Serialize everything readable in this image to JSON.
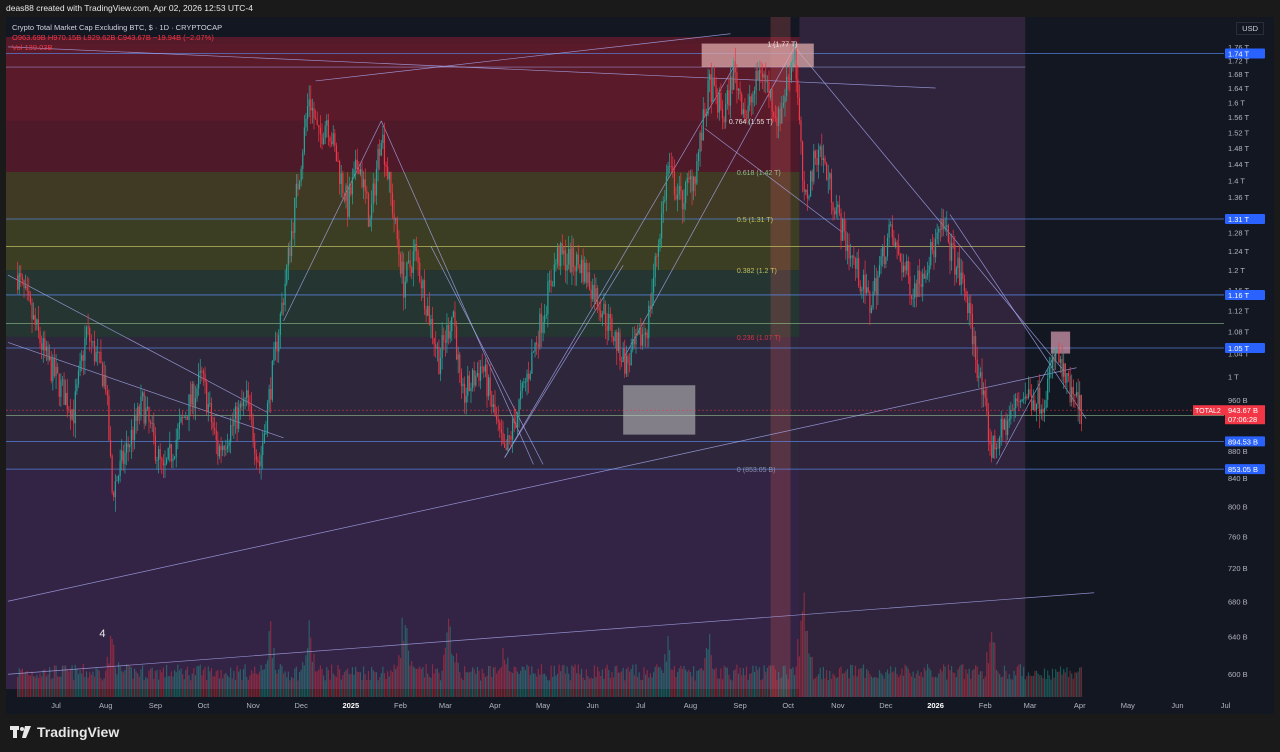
{
  "header": {
    "attribution": "deas88 created with TradingView.com, Apr 02, 2026 12:53 UTC-4"
  },
  "legend": {
    "symbol": "Crypto Total Market Cap Excluding BTC, $ · 1D · CRYPTOCAP",
    "ohlc": "O963.69B H970.15B L929.62B C943.67B −19.94B (−2.07%)",
    "volume": "Vol  139.03B"
  },
  "currency": "USD",
  "footer": {
    "brand": "TradingView"
  },
  "colors": {
    "background": "#131722",
    "up": "#26a69a",
    "down": "#f23645",
    "trendline": "#b2b5ff",
    "level": "#5b8def"
  },
  "chart_data": {
    "type": "candlestick",
    "title": "Crypto Total Market Cap Excluding BTC",
    "interval": "1D",
    "exchange": "CRYPTOCAP",
    "y_scale": "log",
    "ylim": [
      585,
      1790
    ],
    "y_ticks": [
      {
        "value": 600,
        "label": "600 B"
      },
      {
        "value": 640,
        "label": "640 B"
      },
      {
        "value": 680,
        "label": "680 B"
      },
      {
        "value": 720,
        "label": "720 B"
      },
      {
        "value": 760,
        "label": "760 B"
      },
      {
        "value": 800,
        "label": "800 B"
      },
      {
        "value": 840,
        "label": "840 B"
      },
      {
        "value": 880,
        "label": "880 B"
      },
      {
        "value": 960,
        "label": "960 B"
      },
      {
        "value": 1000,
        "label": "1 T"
      },
      {
        "value": 1040,
        "label": "1.04 T"
      },
      {
        "value": 1080,
        "label": "1.08 T"
      },
      {
        "value": 1120,
        "label": "1.12 T"
      },
      {
        "value": 1160,
        "label": "1.16 T"
      },
      {
        "value": 1200,
        "label": "1.2 T"
      },
      {
        "value": 1240,
        "label": "1.24 T"
      },
      {
        "value": 1280,
        "label": "1.28 T"
      },
      {
        "value": 1360,
        "label": "1.36 T"
      },
      {
        "value": 1400,
        "label": "1.4 T"
      },
      {
        "value": 1440,
        "label": "1.44 T"
      },
      {
        "value": 1480,
        "label": "1.48 T"
      },
      {
        "value": 1520,
        "label": "1.52 T"
      },
      {
        "value": 1560,
        "label": "1.56 T"
      },
      {
        "value": 1600,
        "label": "1.6 T"
      },
      {
        "value": 1640,
        "label": "1.64 T"
      },
      {
        "value": 1680,
        "label": "1.68 T"
      },
      {
        "value": 1720,
        "label": "1.72 T"
      },
      {
        "value": 1760,
        "label": "1.76 T"
      }
    ],
    "price_badges": [
      {
        "value": 1740,
        "label": "1.74 T"
      },
      {
        "value": 1310,
        "label": "1.31 T"
      },
      {
        "value": 1150,
        "label": "1.16 T"
      },
      {
        "value": 1050,
        "label": "1.05 T"
      },
      {
        "value": 894.53,
        "label": "894.53 B"
      },
      {
        "value": 853.05,
        "label": "853.05 B"
      }
    ],
    "last_price": {
      "symbol": "TOTAL2",
      "value": 943.67,
      "label": "943.67 B",
      "countdown": "07:06:28"
    },
    "x_ticks": [
      "Jul",
      "Aug",
      "Sep",
      "Oct",
      "Nov",
      "Dec",
      "2025",
      "Feb",
      "Mar",
      "Apr",
      "May",
      "Jun",
      "Jul",
      "Aug",
      "Sep",
      "Oct",
      "Nov",
      "Dec",
      "2026",
      "Feb",
      "Mar",
      "Apr",
      "May",
      "Jun",
      "Jul"
    ],
    "x_tick_dates": [
      "2024-07-01",
      "2024-08-01",
      "2024-09-01",
      "2024-10-01",
      "2024-11-01",
      "2024-12-01",
      "2025-01-01",
      "2025-02-01",
      "2025-03-01",
      "2025-04-01",
      "2025-05-01",
      "2025-06-01",
      "2025-07-01",
      "2025-08-01",
      "2025-09-01",
      "2025-10-01",
      "2025-11-01",
      "2025-12-01",
      "2026-01-01",
      "2026-02-01",
      "2026-03-01",
      "2026-04-01",
      "2026-05-01",
      "2026-06-01",
      "2026-07-01"
    ],
    "price_path": [
      [
        "2024-06-07",
        1190
      ],
      [
        "2024-06-25",
        1030
      ],
      [
        "2024-07-12",
        940
      ],
      [
        "2024-07-20",
        1080
      ],
      [
        "2024-08-01",
        990
      ],
      [
        "2024-08-05",
        820
      ],
      [
        "2024-08-24",
        955
      ],
      [
        "2024-09-06",
        845
      ],
      [
        "2024-09-20",
        940
      ],
      [
        "2024-09-30",
        1000
      ],
      [
        "2024-10-10",
        880
      ],
      [
        "2024-10-28",
        960
      ],
      [
        "2024-11-05",
        860
      ],
      [
        "2024-11-20",
        1150
      ],
      [
        "2024-12-06",
        1620
      ],
      [
        "2024-12-12",
        1500
      ],
      [
        "2024-12-17",
        1560
      ],
      [
        "2024-12-30",
        1340
      ],
      [
        "2025-01-06",
        1450
      ],
      [
        "2025-01-13",
        1300
      ],
      [
        "2025-01-20",
        1530
      ],
      [
        "2025-02-03",
        1170
      ],
      [
        "2025-02-10",
        1240
      ],
      [
        "2025-02-25",
        1030
      ],
      [
        "2025-03-06",
        1120
      ],
      [
        "2025-03-11",
        960
      ],
      [
        "2025-03-24",
        1020
      ],
      [
        "2025-04-07",
        870
      ],
      [
        "2025-04-22",
        1010
      ],
      [
        "2025-05-10",
        1230
      ],
      [
        "2025-05-25",
        1210
      ],
      [
        "2025-06-06",
        1130
      ],
      [
        "2025-06-22",
        1020
      ],
      [
        "2025-07-05",
        1090
      ],
      [
        "2025-07-18",
        1430
      ],
      [
        "2025-07-26",
        1350
      ],
      [
        "2025-08-04",
        1420
      ],
      [
        "2025-08-13",
        1650
      ],
      [
        "2025-08-22",
        1560
      ],
      [
        "2025-08-28",
        1690
      ],
      [
        "2025-09-05",
        1560
      ],
      [
        "2025-09-14",
        1700
      ],
      [
        "2025-09-25",
        1550
      ],
      [
        "2025-10-05",
        1760
      ],
      [
        "2025-10-11",
        1340
      ],
      [
        "2025-10-20",
        1490
      ],
      [
        "2025-11-04",
        1280
      ],
      [
        "2025-11-21",
        1130
      ],
      [
        "2025-12-03",
        1280
      ],
      [
        "2025-12-18",
        1160
      ],
      [
        "2026-01-06",
        1290
      ],
      [
        "2026-01-20",
        1150
      ],
      [
        "2026-02-05",
        880
      ],
      [
        "2026-02-24",
        970
      ],
      [
        "2026-03-09",
        960
      ],
      [
        "2026-03-17",
        1040
      ],
      [
        "2026-03-26",
        970
      ],
      [
        "2026-04-02",
        944
      ]
    ],
    "volume_peaks": [
      [
        "2024-08-05",
        0.55
      ],
      [
        "2024-11-12",
        0.65
      ],
      [
        "2024-12-06",
        0.6
      ],
      [
        "2025-02-03",
        0.75
      ],
      [
        "2025-03-04",
        0.7
      ],
      [
        "2025-04-07",
        0.5
      ],
      [
        "2025-07-18",
        0.5
      ],
      [
        "2025-08-13",
        0.5
      ],
      [
        "2025-10-11",
        0.9
      ],
      [
        "2026-02-05",
        0.6
      ]
    ],
    "fib_levels": [
      {
        "label": "1 (1.77 T)",
        "value": 1770
      },
      {
        "label": "0.764 (1.55 T)",
        "value": 1550
      },
      {
        "label": "0.618 (1.42 T)",
        "value": 1420
      },
      {
        "label": "0.5 (1.31 T)",
        "value": 1310
      },
      {
        "label": "0.382 (1.2 T)",
        "value": 1200
      },
      {
        "label": "0.236 (1.07 T)",
        "value": 1070
      },
      {
        "label": "0 (853.05 B)",
        "value": 853.05
      }
    ],
    "annotation": "4",
    "grid": false
  }
}
